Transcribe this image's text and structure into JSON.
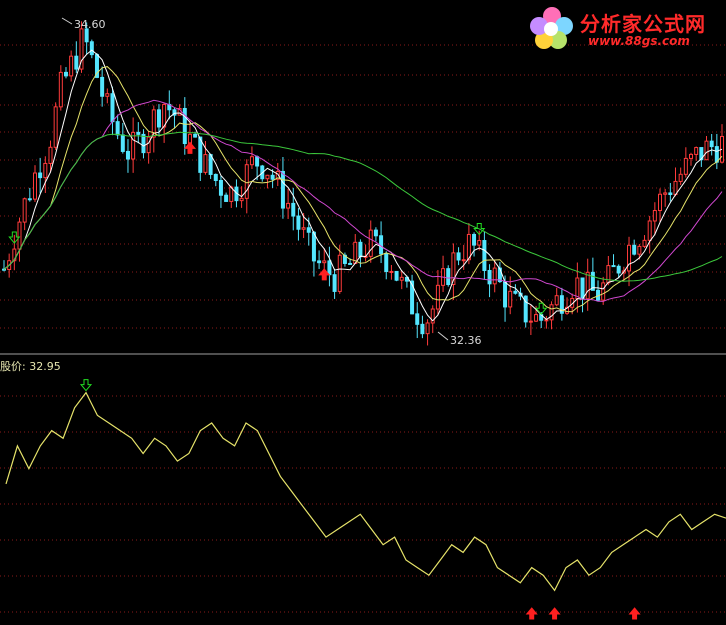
{
  "logo": {
    "title": "分析家公式网",
    "url": "www.88gs.com"
  },
  "indicator": {
    "name": "股价:",
    "value": "32.95"
  },
  "price_labels": {
    "high": "34.60",
    "low": "32.36"
  },
  "colors": {
    "background": "#000000",
    "up_candle": "#ff3b3b",
    "down_candle": "#54e6ff",
    "ma_short": "#ffffff",
    "ma_mid": "#e6e36a",
    "ma_long": "#d048d0",
    "ma_trend": "#3cc83c",
    "price_line": "#e6e36a",
    "buy_arrow": "#ff2020",
    "sell_arrow": "#22dd22",
    "grid": "#8a1a1a",
    "separator": "#a0a0a0"
  },
  "chart_data": [
    {
      "type": "candlestick",
      "title": "",
      "series": [
        {
          "name": "",
          "values": [
            31.0,
            31.6,
            32.1,
            32.6,
            33.0,
            33.8,
            34.2,
            34.6,
            34.1,
            33.5,
            33.1,
            32.8,
            33.0,
            33.3,
            33.6,
            33.4,
            33.1,
            32.8,
            32.5,
            32.3,
            32.2,
            32.4,
            32.7,
            32.6,
            32.3,
            32.0,
            31.6,
            31.2,
            31.0,
            30.9,
            31.0,
            31.2,
            31.4,
            31.3,
            31.1,
            30.7,
            30.4,
            30.2,
            30.5,
            31.0,
            31.3,
            31.4,
            31.1,
            30.9,
            30.6,
            30.4,
            30.3,
            30.2,
            30.4,
            30.6,
            30.8,
            30.7,
            30.6,
            30.8,
            31.1,
            31.4,
            31.6,
            31.9,
            32.2,
            32.4,
            32.6,
            32.8,
            32.9,
            32.95
          ]
        }
      ],
      "markers": [
        {
          "kind": "sell",
          "at": 2
        },
        {
          "kind": "buy",
          "at": 36
        },
        {
          "kind": "buy",
          "at": 62
        },
        {
          "kind": "sell",
          "at": 92
        },
        {
          "kind": "sell",
          "at": 104
        }
      ]
    },
    {
      "type": "line",
      "series": [
        {
          "name": "股价",
          "values": [
            33.4,
            33.9,
            33.6,
            33.9,
            34.1,
            34.0,
            34.4,
            34.6,
            34.3,
            34.2,
            34.1,
            34.0,
            33.8,
            34.0,
            33.9,
            33.7,
            33.8,
            34.1,
            34.2,
            34.0,
            33.9,
            34.2,
            34.1,
            33.8,
            33.5,
            33.3,
            33.1,
            32.9,
            32.7,
            32.8,
            32.9,
            33.0,
            32.8,
            32.6,
            32.7,
            32.4,
            32.3,
            32.2,
            32.4,
            32.6,
            32.5,
            32.7,
            32.6,
            32.3,
            32.2,
            32.1,
            32.3,
            32.2,
            32.0,
            32.3,
            32.4,
            32.2,
            32.3,
            32.5,
            32.6,
            32.7,
            32.8,
            32.7,
            32.9,
            33.0,
            32.8,
            32.9,
            33.0,
            32.95
          ]
        }
      ],
      "markers": [
        {
          "kind": "sell",
          "at": 7
        },
        {
          "kind": "buy",
          "at": 46
        },
        {
          "kind": "buy",
          "at": 48
        },
        {
          "kind": "buy",
          "at": 55
        }
      ]
    }
  ]
}
